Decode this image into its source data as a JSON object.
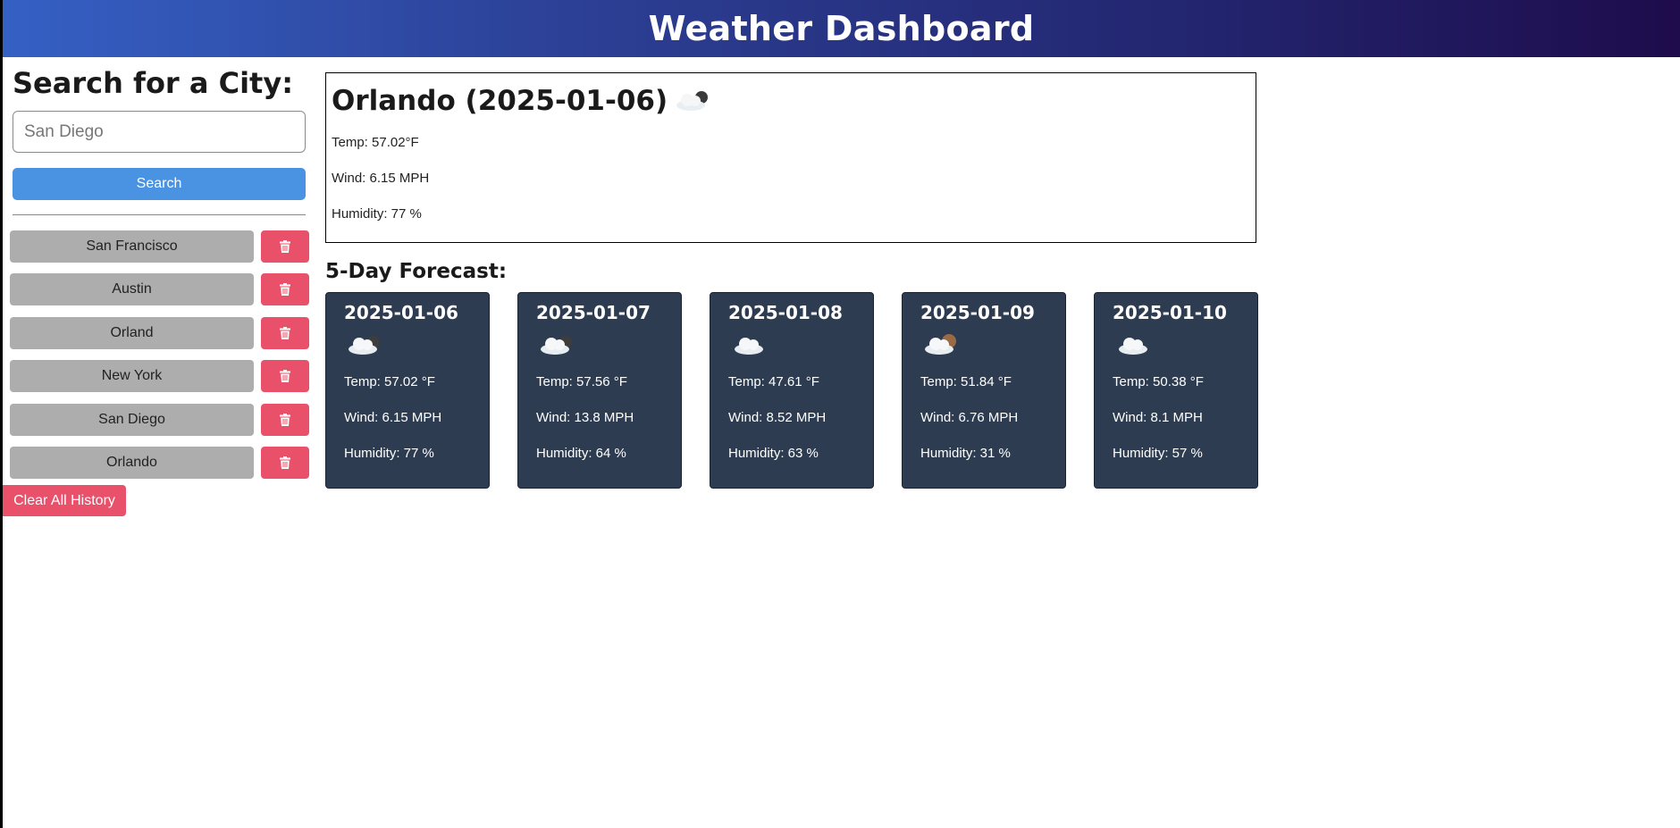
{
  "header": {
    "title": "Weather Dashboard"
  },
  "sidebar": {
    "heading": "Search for a City:",
    "search_placeholder": "San Diego",
    "search_button": "Search",
    "history": [
      {
        "city": "San Francisco",
        "delete_icon": "trash-icon"
      },
      {
        "city": "Austin",
        "delete_icon": "trash-icon"
      },
      {
        "city": "Orland",
        "delete_icon": "trash-icon"
      },
      {
        "city": "New York",
        "delete_icon": "trash-icon"
      },
      {
        "city": "San Diego",
        "delete_icon": "trash-icon"
      },
      {
        "city": "Orlando",
        "delete_icon": "trash-icon"
      }
    ],
    "clear_button": "Clear All History"
  },
  "current": {
    "title": "Orlando (2025-01-06)",
    "icon": "cloud-moon-icon",
    "temp": "Temp: 57.02°F",
    "wind": "Wind: 6.15 MPH",
    "humidity": "Humidity: 77 %"
  },
  "forecast": {
    "title": "5-Day Forecast:",
    "days": [
      {
        "date": "2025-01-06",
        "icon": "cloud-moon-icon",
        "temp": "Temp: 57.02 °F",
        "wind": "Wind: 6.15 MPH",
        "humidity": "Humidity: 77 %"
      },
      {
        "date": "2025-01-07",
        "icon": "cloud-moon-icon",
        "temp": "Temp: 57.56 °F",
        "wind": "Wind: 13.8 MPH",
        "humidity": "Humidity: 64 %"
      },
      {
        "date": "2025-01-08",
        "icon": "cloud-icon",
        "temp": "Temp: 47.61 °F",
        "wind": "Wind: 8.52 MPH",
        "humidity": "Humidity: 63 %"
      },
      {
        "date": "2025-01-09",
        "icon": "cloud-sun-icon",
        "temp": "Temp: 51.84 °F",
        "wind": "Wind: 6.76 MPH",
        "humidity": "Humidity: 31 %"
      },
      {
        "date": "2025-01-10",
        "icon": "cloud-icon",
        "temp": "Temp: 50.38 °F",
        "wind": "Wind: 8.1 MPH",
        "humidity": "Humidity: 57 %"
      }
    ]
  },
  "colors": {
    "search_button": "#4a92e2",
    "delete_button": "#e9506a",
    "history_button": "#adadad",
    "card_background": "#2d3c51"
  }
}
